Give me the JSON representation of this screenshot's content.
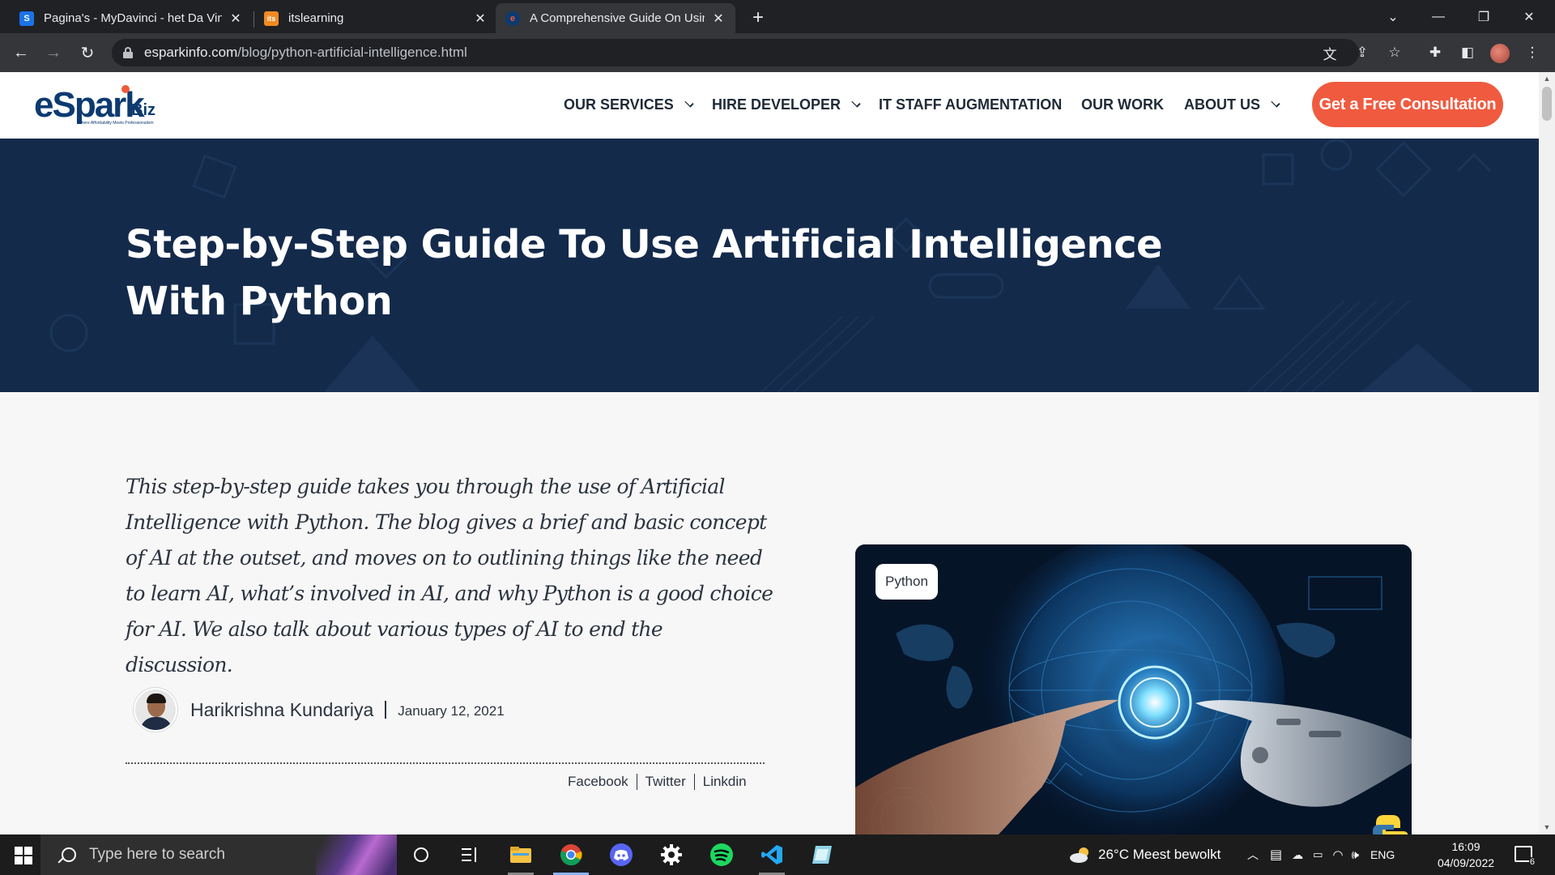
{
  "browser": {
    "tabs": [
      {
        "title": "Pagina's - MyDavinci - het Da Vinci",
        "favicon_text": "S",
        "favicon_color": "#1a73e8",
        "active": false
      },
      {
        "title": "itslearning",
        "favicon_text": "its",
        "favicon_color": "#f08a24",
        "active": false
      },
      {
        "title": "A Comprehensive Guide On Using",
        "favicon_text": "e",
        "favicon_color": "#0d3a70",
        "active": true
      }
    ],
    "url_host": "esparkinfo.com",
    "url_path": "/blog/python-artificial-intelligence.html"
  },
  "site": {
    "logo_text": "eSpark",
    "logo_biz": "Biz",
    "logo_tagline": "Where Affordability Meets Professionalism",
    "nav": [
      {
        "label": "OUR SERVICES",
        "has_dropdown": true
      },
      {
        "label": "HIRE DEVELOPER",
        "has_dropdown": true
      },
      {
        "label": "IT STAFF AUGMENTATION",
        "has_dropdown": false
      },
      {
        "label": "OUR WORK",
        "has_dropdown": false
      },
      {
        "label": "ABOUT US",
        "has_dropdown": true
      }
    ],
    "cta_label": "Get a Free Consultation"
  },
  "article": {
    "title": "Step-by-Step Guide To Use Artificial Intelligence With Python",
    "intro": "This step-by-step guide takes you through the use of Artificial Intelligence with Python. The blog gives a brief and basic concept of AI at the outset, and moves on to outlining things like the need to learn AI, what’s involved in AI, and why Python is a good choice for AI. We also talk about various types of AI to end the discussion.",
    "author": "Harikrishna Kundariya",
    "date": "January 12, 2021",
    "share_links": [
      "Facebook",
      "Twitter",
      "Linkdin"
    ],
    "image_tag": "Python"
  },
  "taskbar": {
    "search_placeholder": "Type here to search",
    "weather": "26°C  Meest bewolkt",
    "language": "ENG",
    "time": "16:09",
    "date": "04/09/2022",
    "notification_count": "6"
  },
  "colors": {
    "hero_bg": "#132a4b",
    "cta": "#f05a3f",
    "brand": "#0d3a70"
  }
}
